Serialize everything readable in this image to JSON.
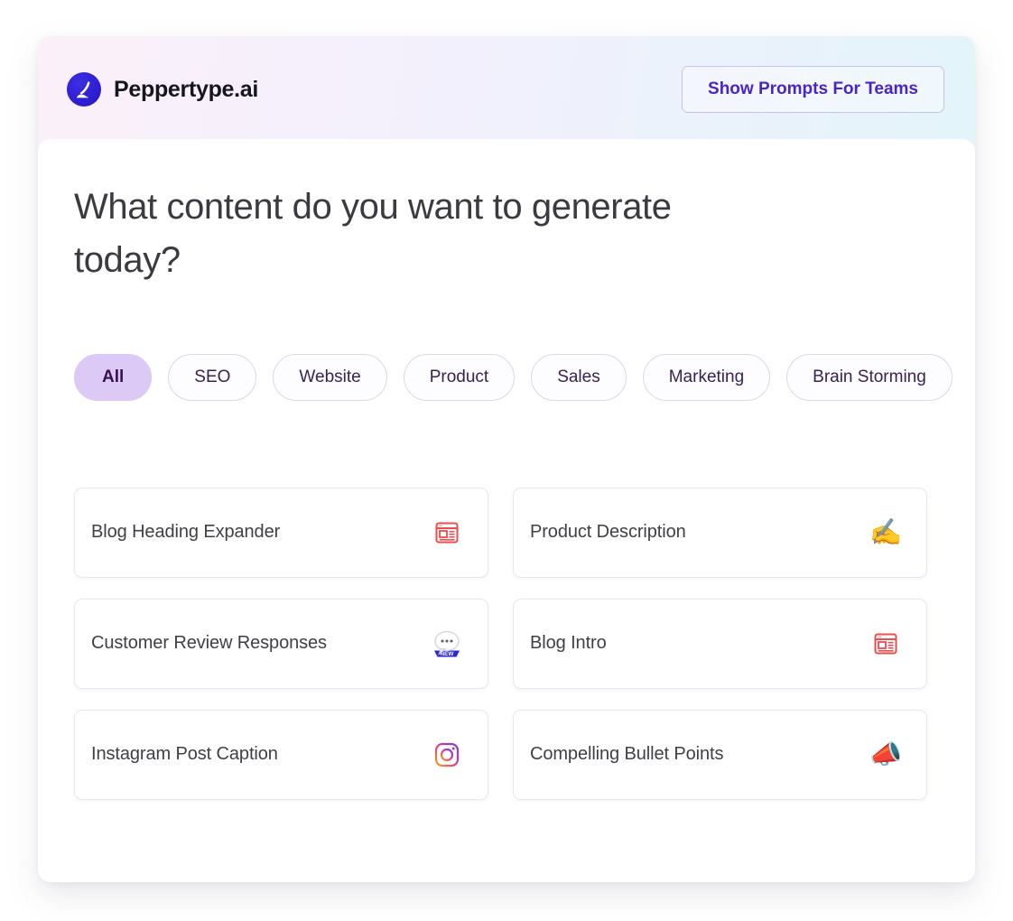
{
  "header": {
    "brand_name": "Peppertype.ai",
    "brand_icon": "feather-quill-icon",
    "teams_button_label": "Show Prompts For Teams"
  },
  "main": {
    "heading": "What content do you want to generate today?",
    "filters": [
      {
        "label": "All",
        "active": true
      },
      {
        "label": "SEO",
        "active": false
      },
      {
        "label": "Website",
        "active": false
      },
      {
        "label": "Product",
        "active": false
      },
      {
        "label": "Sales",
        "active": false
      },
      {
        "label": "Marketing",
        "active": false
      },
      {
        "label": "Brain Storming",
        "active": false
      }
    ],
    "cards": [
      {
        "label": "Blog Heading Expander",
        "icon": "newspaper-icon",
        "badge": ""
      },
      {
        "label": "Product Description",
        "icon": "writing-hand-icon",
        "badge": ""
      },
      {
        "label": "Customer Review Responses",
        "icon": "speech-balloon-icon",
        "badge": "NEW"
      },
      {
        "label": "Blog Intro",
        "icon": "newspaper-icon",
        "badge": ""
      },
      {
        "label": "Instagram Post Caption",
        "icon": "instagram-icon",
        "badge": ""
      },
      {
        "label": "Compelling Bullet Points",
        "icon": "megaphone-icon",
        "badge": ""
      }
    ]
  },
  "colors": {
    "brand_indigo": "#2f1fd6",
    "accent_purple": "#4a24c9",
    "chip_active_bg": "#ddc9f5",
    "icon_red": "#ec4d4d",
    "badge_blue": "#2a2ad0",
    "header_gradient_start": "#fbf0fa",
    "header_gradient_end": "#e0f5fb"
  }
}
